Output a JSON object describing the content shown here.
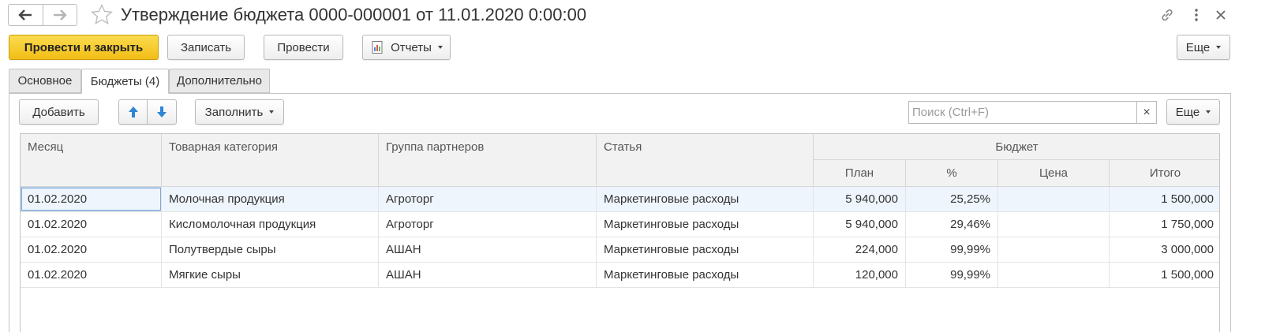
{
  "window": {
    "title": "Утверждение бюджета 0000-000001 от 11.01.2020 0:00:00"
  },
  "toolbar": {
    "post_close_label": "Провести и закрыть",
    "save_label": "Записать",
    "post_label": "Провести",
    "reports_label": "Отчеты",
    "more_label": "Еще"
  },
  "tabs": [
    {
      "label": "Основное"
    },
    {
      "label": "Бюджеты (4)"
    },
    {
      "label": "Дополнительно"
    }
  ],
  "table_toolbar": {
    "add_label": "Добавить",
    "fill_label": "Заполнить",
    "search_placeholder": "Поиск (Ctrl+F)",
    "more_label": "Еще"
  },
  "table": {
    "headers": {
      "month": "Месяц",
      "category": "Товарная категория",
      "partners": "Группа партнеров",
      "article": "Статья",
      "budget": "Бюджет",
      "plan": "План",
      "percent": "%",
      "price": "Цена",
      "total": "Итого"
    },
    "rows": [
      {
        "month": "01.02.2020",
        "category": "Молочная продукция",
        "partners": "Агроторг",
        "article": "Маркетинговые расходы",
        "plan": "5 940,000",
        "percent": "25,25%",
        "price": "",
        "total": "1 500,000"
      },
      {
        "month": "01.02.2020",
        "category": "Кисломолочная продукция",
        "partners": "Агроторг",
        "article": "Маркетинговые расходы",
        "plan": "5 940,000",
        "percent": "29,46%",
        "price": "",
        "total": "1 750,000"
      },
      {
        "month": "01.02.2020",
        "category": "Полутвердые сыры",
        "partners": "АШАН",
        "article": "Маркетинговые расходы",
        "plan": "224,000",
        "percent": "99,99%",
        "price": "",
        "total": "3 000,000"
      },
      {
        "month": "01.02.2020",
        "category": "Мягкие сыры",
        "partners": "АШАН",
        "article": "Маркетинговые расходы",
        "plan": "120,000",
        "percent": "99,99%",
        "price": "",
        "total": "1 500,000"
      }
    ]
  },
  "icons": {
    "back": "arrow-left-icon",
    "forward": "arrow-right-icon",
    "favorite": "star-icon",
    "link": "link-icon",
    "menu": "kebab-menu-icon",
    "close": "close-icon",
    "reports": "report-icon",
    "move_up": "arrow-up-icon",
    "move_down": "arrow-down-icon"
  },
  "colors": {
    "primary_button": "#f2be16",
    "selected_row": "#eef5fc",
    "move_arrows": "#2f86d4"
  }
}
